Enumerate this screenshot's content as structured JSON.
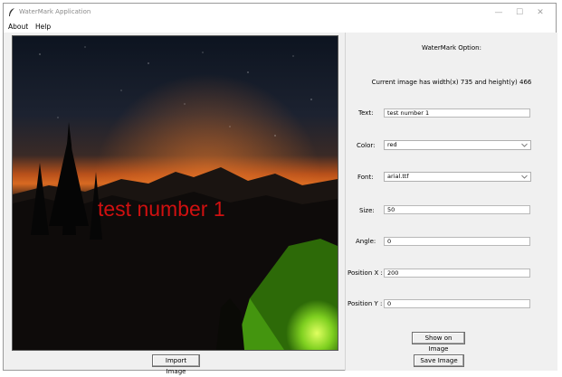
{
  "window": {
    "title": "WaterMark Application",
    "controls": {
      "minimize": "—",
      "maximize": "☐",
      "close": "✕"
    }
  },
  "menu": {
    "items": [
      "About",
      "Help"
    ]
  },
  "image": {
    "watermark_text": "test number 1",
    "watermark_color": "#d01010",
    "import_label": "Import Image"
  },
  "panel": {
    "title": "WaterMark Option:",
    "info": "Current image has width(x) 735 and height(y) 466",
    "text": {
      "label": "Text:",
      "value": "test number 1"
    },
    "color": {
      "label": "Color:",
      "value": "red"
    },
    "font": {
      "label": "Font:",
      "value": "arial.ttf"
    },
    "size": {
      "label": "Size:",
      "value": "50"
    },
    "angle": {
      "label": "Angle:",
      "value": "0"
    },
    "pos_x": {
      "label": "Position X :",
      "value": "200"
    },
    "pos_y": {
      "label": "Position Y :",
      "value": "0"
    },
    "show_label": "Show on Image",
    "save_label": "Save Image"
  }
}
